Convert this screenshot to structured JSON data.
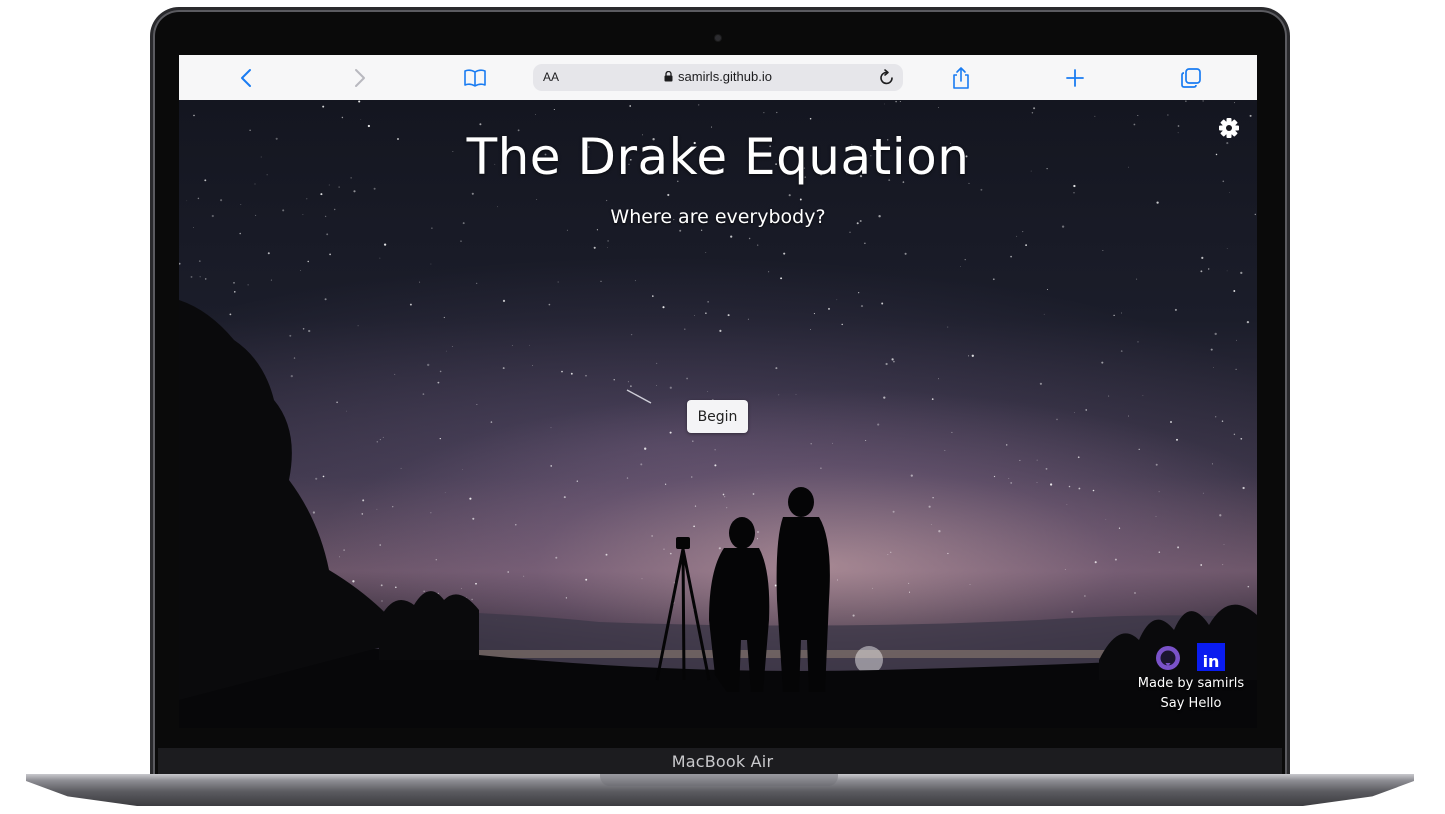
{
  "device": {
    "model_label": "MacBook Air"
  },
  "browser": {
    "text_size_label": "AA",
    "url": "samirls.github.io",
    "icons": {
      "back": "chevron-left-icon",
      "forward": "chevron-right-icon",
      "bookmarks": "book-icon",
      "lock": "lock-icon",
      "reload": "reload-icon",
      "share": "share-icon",
      "new_tab": "plus-icon",
      "tabs": "tabs-icon"
    },
    "accent_color": "#1a7cf2"
  },
  "page": {
    "title": "The Drake Equation",
    "subtitle": "Where are everybody?",
    "begin_label": "Begin",
    "settings_icon": "gear-icon",
    "footer": {
      "github_icon": "github-icon",
      "linkedin_icon": "linkedin-icon",
      "linkedin_text": "in",
      "made_by": "Made by samirls",
      "say_hello": "Say Hello"
    }
  }
}
